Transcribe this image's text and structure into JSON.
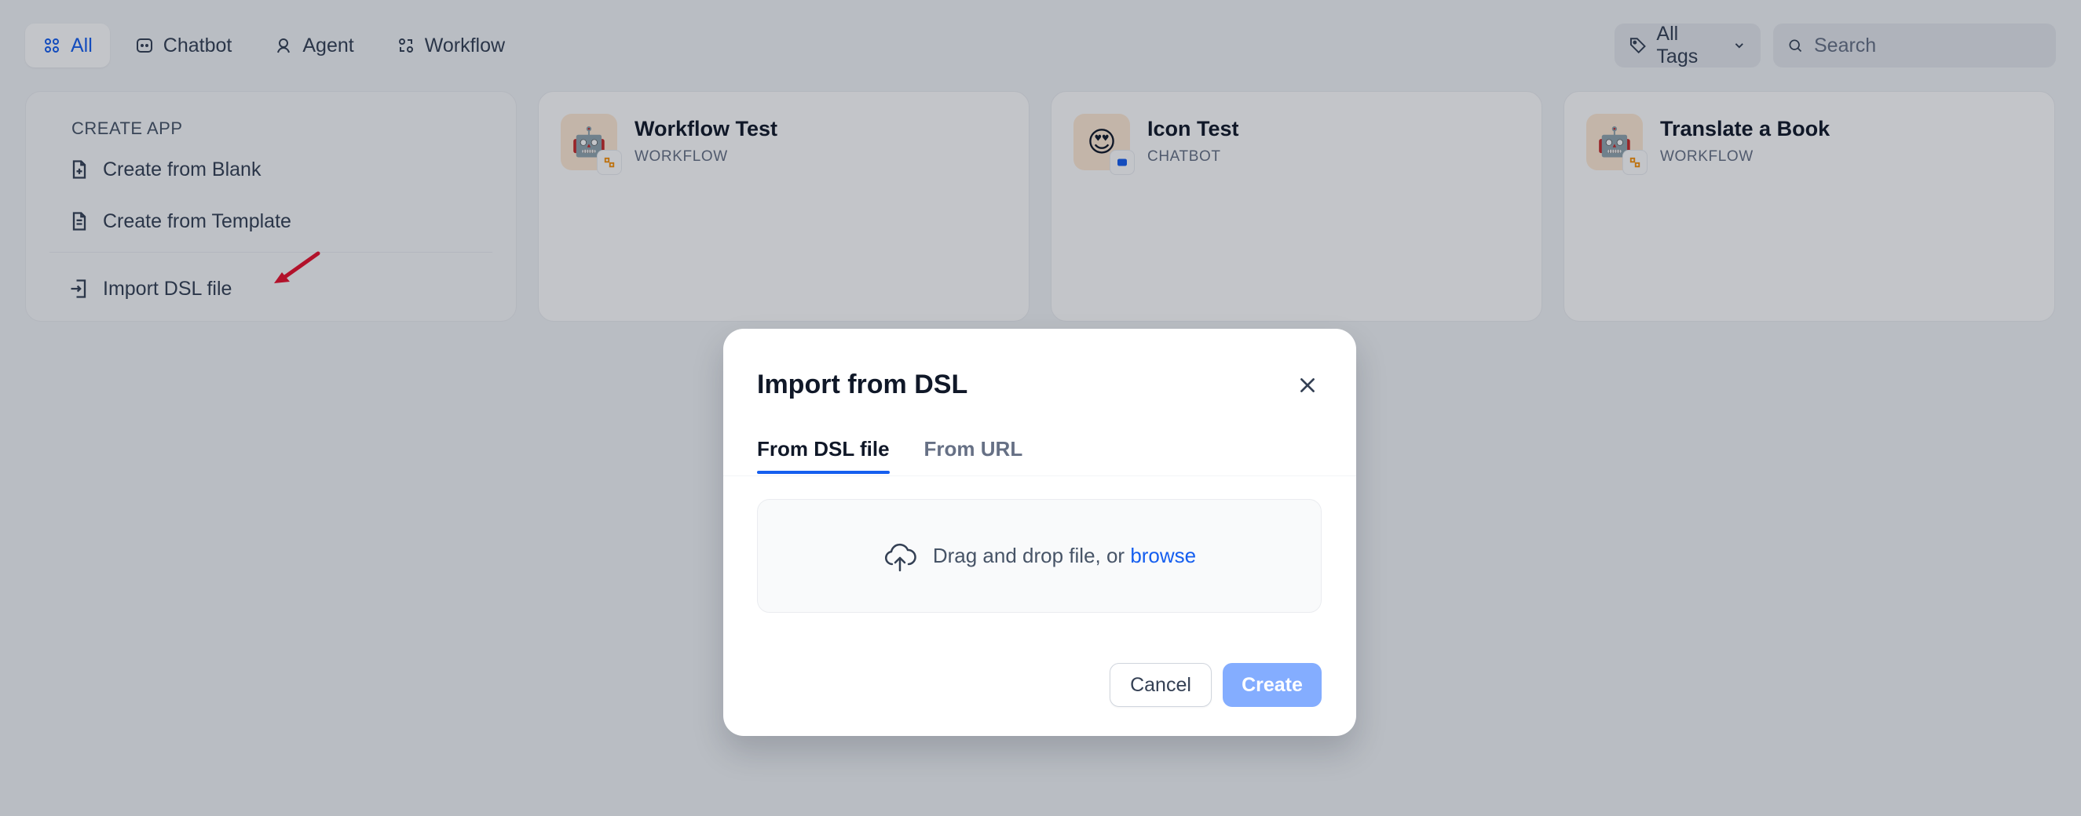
{
  "filters": {
    "tabs": [
      {
        "label": "All",
        "icon": "grid-icon",
        "active": true
      },
      {
        "label": "Chatbot",
        "icon": "chat-icon",
        "active": false
      },
      {
        "label": "Agent",
        "icon": "robot-icon",
        "active": false
      },
      {
        "label": "Workflow",
        "icon": "workflow-icon",
        "active": false
      }
    ],
    "tags_label": "All Tags",
    "search_placeholder": "Search"
  },
  "create_app": {
    "title": "CREATE APP",
    "items": [
      {
        "label": "Create from Blank",
        "icon": "file-plus-icon"
      },
      {
        "label": "Create from Template",
        "icon": "file-template-icon"
      },
      {
        "label": "Import DSL file",
        "icon": "file-import-icon"
      }
    ]
  },
  "apps": [
    {
      "name": "Workflow Test",
      "type": "WORKFLOW",
      "emoji": "🤖",
      "badge": "workflow-badge-icon"
    },
    {
      "name": "Icon Test",
      "type": "CHATBOT",
      "emoji": "😍",
      "badge": "chatbot-badge-icon"
    },
    {
      "name": "Translate a Book",
      "type": "WORKFLOW",
      "emoji": "🤖",
      "badge": "workflow-badge-icon"
    }
  ],
  "modal": {
    "title": "Import from DSL",
    "tabs": [
      {
        "label": "From DSL file",
        "active": true
      },
      {
        "label": "From URL",
        "active": false
      }
    ],
    "dropzone_text": "Drag and drop file, or ",
    "dropzone_link": "browse",
    "cancel_label": "Cancel",
    "create_label": "Create"
  },
  "colors": {
    "accent": "#155eef",
    "create_disabled": "#84adff",
    "annotation_arrow": "#e8112d"
  }
}
